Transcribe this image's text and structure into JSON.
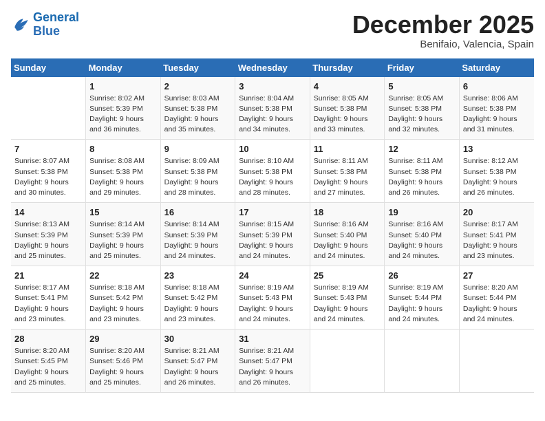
{
  "header": {
    "logo_line1": "General",
    "logo_line2": "Blue",
    "month": "December 2025",
    "location": "Benifaio, Valencia, Spain"
  },
  "weekdays": [
    "Sunday",
    "Monday",
    "Tuesday",
    "Wednesday",
    "Thursday",
    "Friday",
    "Saturday"
  ],
  "weeks": [
    [
      {
        "day": "",
        "detail": ""
      },
      {
        "day": "1",
        "detail": "Sunrise: 8:02 AM\nSunset: 5:39 PM\nDaylight: 9 hours\nand 36 minutes."
      },
      {
        "day": "2",
        "detail": "Sunrise: 8:03 AM\nSunset: 5:38 PM\nDaylight: 9 hours\nand 35 minutes."
      },
      {
        "day": "3",
        "detail": "Sunrise: 8:04 AM\nSunset: 5:38 PM\nDaylight: 9 hours\nand 34 minutes."
      },
      {
        "day": "4",
        "detail": "Sunrise: 8:05 AM\nSunset: 5:38 PM\nDaylight: 9 hours\nand 33 minutes."
      },
      {
        "day": "5",
        "detail": "Sunrise: 8:05 AM\nSunset: 5:38 PM\nDaylight: 9 hours\nand 32 minutes."
      },
      {
        "day": "6",
        "detail": "Sunrise: 8:06 AM\nSunset: 5:38 PM\nDaylight: 9 hours\nand 31 minutes."
      }
    ],
    [
      {
        "day": "7",
        "detail": "Sunrise: 8:07 AM\nSunset: 5:38 PM\nDaylight: 9 hours\nand 30 minutes."
      },
      {
        "day": "8",
        "detail": "Sunrise: 8:08 AM\nSunset: 5:38 PM\nDaylight: 9 hours\nand 29 minutes."
      },
      {
        "day": "9",
        "detail": "Sunrise: 8:09 AM\nSunset: 5:38 PM\nDaylight: 9 hours\nand 28 minutes."
      },
      {
        "day": "10",
        "detail": "Sunrise: 8:10 AM\nSunset: 5:38 PM\nDaylight: 9 hours\nand 28 minutes."
      },
      {
        "day": "11",
        "detail": "Sunrise: 8:11 AM\nSunset: 5:38 PM\nDaylight: 9 hours\nand 27 minutes."
      },
      {
        "day": "12",
        "detail": "Sunrise: 8:11 AM\nSunset: 5:38 PM\nDaylight: 9 hours\nand 26 minutes."
      },
      {
        "day": "13",
        "detail": "Sunrise: 8:12 AM\nSunset: 5:38 PM\nDaylight: 9 hours\nand 26 minutes."
      }
    ],
    [
      {
        "day": "14",
        "detail": "Sunrise: 8:13 AM\nSunset: 5:39 PM\nDaylight: 9 hours\nand 25 minutes."
      },
      {
        "day": "15",
        "detail": "Sunrise: 8:14 AM\nSunset: 5:39 PM\nDaylight: 9 hours\nand 25 minutes."
      },
      {
        "day": "16",
        "detail": "Sunrise: 8:14 AM\nSunset: 5:39 PM\nDaylight: 9 hours\nand 24 minutes."
      },
      {
        "day": "17",
        "detail": "Sunrise: 8:15 AM\nSunset: 5:39 PM\nDaylight: 9 hours\nand 24 minutes."
      },
      {
        "day": "18",
        "detail": "Sunrise: 8:16 AM\nSunset: 5:40 PM\nDaylight: 9 hours\nand 24 minutes."
      },
      {
        "day": "19",
        "detail": "Sunrise: 8:16 AM\nSunset: 5:40 PM\nDaylight: 9 hours\nand 24 minutes."
      },
      {
        "day": "20",
        "detail": "Sunrise: 8:17 AM\nSunset: 5:41 PM\nDaylight: 9 hours\nand 23 minutes."
      }
    ],
    [
      {
        "day": "21",
        "detail": "Sunrise: 8:17 AM\nSunset: 5:41 PM\nDaylight: 9 hours\nand 23 minutes."
      },
      {
        "day": "22",
        "detail": "Sunrise: 8:18 AM\nSunset: 5:42 PM\nDaylight: 9 hours\nand 23 minutes."
      },
      {
        "day": "23",
        "detail": "Sunrise: 8:18 AM\nSunset: 5:42 PM\nDaylight: 9 hours\nand 23 minutes."
      },
      {
        "day": "24",
        "detail": "Sunrise: 8:19 AM\nSunset: 5:43 PM\nDaylight: 9 hours\nand 24 minutes."
      },
      {
        "day": "25",
        "detail": "Sunrise: 8:19 AM\nSunset: 5:43 PM\nDaylight: 9 hours\nand 24 minutes."
      },
      {
        "day": "26",
        "detail": "Sunrise: 8:19 AM\nSunset: 5:44 PM\nDaylight: 9 hours\nand 24 minutes."
      },
      {
        "day": "27",
        "detail": "Sunrise: 8:20 AM\nSunset: 5:44 PM\nDaylight: 9 hours\nand 24 minutes."
      }
    ],
    [
      {
        "day": "28",
        "detail": "Sunrise: 8:20 AM\nSunset: 5:45 PM\nDaylight: 9 hours\nand 25 minutes."
      },
      {
        "day": "29",
        "detail": "Sunrise: 8:20 AM\nSunset: 5:46 PM\nDaylight: 9 hours\nand 25 minutes."
      },
      {
        "day": "30",
        "detail": "Sunrise: 8:21 AM\nSunset: 5:47 PM\nDaylight: 9 hours\nand 26 minutes."
      },
      {
        "day": "31",
        "detail": "Sunrise: 8:21 AM\nSunset: 5:47 PM\nDaylight: 9 hours\nand 26 minutes."
      },
      {
        "day": "",
        "detail": ""
      },
      {
        "day": "",
        "detail": ""
      },
      {
        "day": "",
        "detail": ""
      }
    ]
  ]
}
